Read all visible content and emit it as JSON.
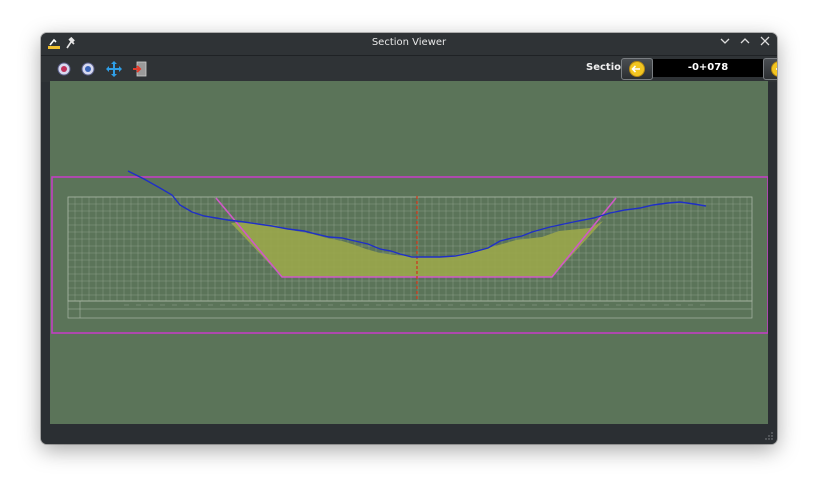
{
  "window": {
    "title": "Section Viewer",
    "controls": [
      "minimize",
      "maximize",
      "close"
    ]
  },
  "toolbar": {
    "tools": [
      {
        "name": "zoom-in-icon"
      },
      {
        "name": "zoom-out-icon"
      },
      {
        "name": "pan-icon"
      },
      {
        "name": "exit-icon"
      }
    ],
    "section_label": "Section :",
    "section_value": "-0+078"
  },
  "colors": {
    "canvas": "#5b7459",
    "frame": "#c23fc3",
    "terrain": "#1f2fc7",
    "fill": "#9aa74a",
    "center_line": "#cc3a1d",
    "grid": "#a9b7a5"
  },
  "section": {
    "has_grid": true,
    "has_center_line": true
  }
}
